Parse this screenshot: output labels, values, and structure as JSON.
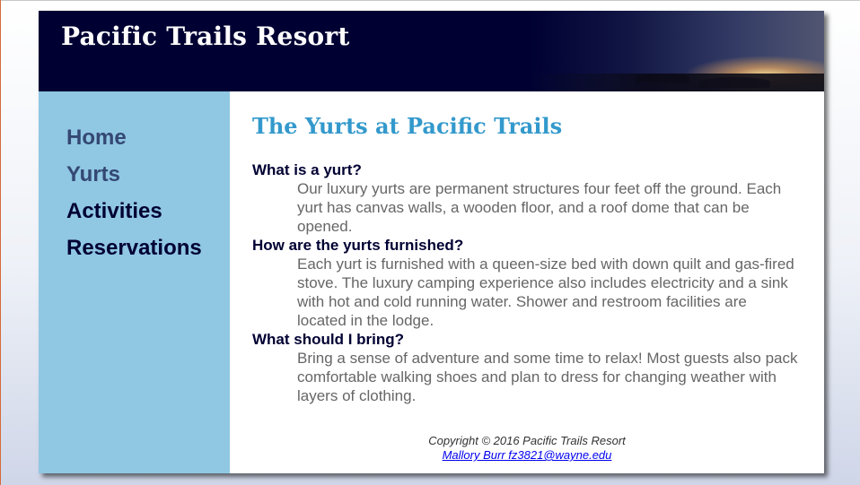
{
  "site": {
    "title": "Pacific Trails Resort"
  },
  "nav": {
    "items": [
      {
        "label": "Home"
      },
      {
        "label": "Yurts"
      },
      {
        "label": "Activities"
      },
      {
        "label": "Reservations"
      }
    ]
  },
  "main": {
    "heading": "The Yurts at Pacific Trails",
    "faq": [
      {
        "question": "What is a yurt?",
        "answer": "Our luxury yurts are permanent structures four feet off the ground. Each yurt has canvas walls, a wooden floor, and a roof dome that can be opened."
      },
      {
        "question": "How are the yurts furnished?",
        "answer": "Each yurt is furnished with a queen-size bed with down quilt and gas-fired stove. The luxury camping experience also includes electricity and a sink with hot and cold running water. Shower and restroom facilities are located in the lodge."
      },
      {
        "question": "What should I bring?",
        "answer": "Bring a sense of adventure and some time to relax! Most guests also pack comfortable walking shoes and plan to dress for changing weather with layers of clothing."
      }
    ]
  },
  "footer": {
    "copyright": "Copyright © 2016 Pacific Trails Resort",
    "contact_link": "Mallory Burr fz3821@wayne.edu"
  },
  "colors": {
    "header_bg": "#000033",
    "nav_bg": "#90c7e3",
    "heading": "#3399cc",
    "body_text": "#666666"
  }
}
